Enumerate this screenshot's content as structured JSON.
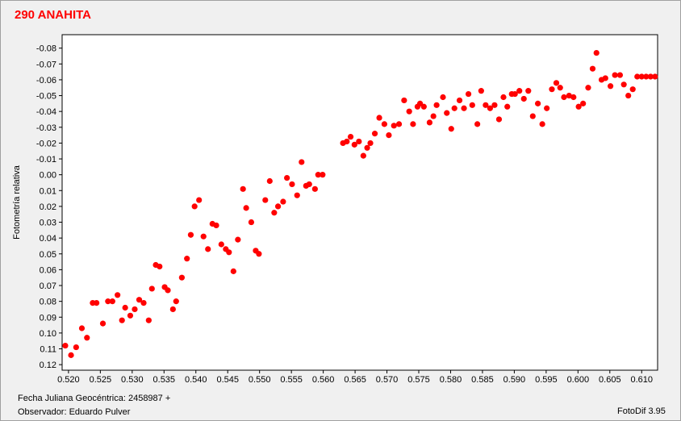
{
  "chart_data": {
    "type": "scatter",
    "title": "290 ANAHITA",
    "xlabel": "Fecha Juliana Geocéntrica: 2458987 +",
    "ylabel": "Fotometría relativa",
    "xlim": [
      0.519,
      0.6125
    ],
    "ylim": [
      -0.0885,
      0.1235
    ],
    "y_inverted": true,
    "grid": false,
    "x_ticks": [
      0.52,
      0.525,
      0.53,
      0.535,
      0.54,
      0.545,
      0.55,
      0.555,
      0.56,
      0.565,
      0.57,
      0.575,
      0.58,
      0.585,
      0.59,
      0.595,
      0.6,
      0.605,
      0.61
    ],
    "x_tick_labels": [
      "0.520",
      "0.525",
      "0.530",
      "0.535",
      "0.540",
      "0.545",
      "0.550",
      "0.555",
      "0.560",
      "0.565",
      "0.570",
      "0.575",
      "0.580",
      "0.585",
      "0.590",
      "0.595",
      "0.600",
      "0.605",
      "0.610"
    ],
    "y_ticks": [
      -0.08,
      -0.07,
      -0.06,
      -0.05,
      -0.04,
      -0.03,
      -0.02,
      -0.01,
      0.0,
      0.01,
      0.02,
      0.03,
      0.04,
      0.05,
      0.06,
      0.07,
      0.08,
      0.09,
      0.1,
      0.11,
      0.12
    ],
    "y_tick_labels": [
      "-0.08",
      "-0.07",
      "-0.06",
      "-0.05",
      "-0.04",
      "-0.03",
      "-0.02",
      "-0.01",
      "0.00",
      "0.01",
      "0.02",
      "0.03",
      "0.04",
      "0.05",
      "0.06",
      "0.07",
      "0.08",
      "0.09",
      "0.10",
      "0.11",
      "0.12"
    ],
    "point_color": "#ff0000",
    "series": [
      {
        "points": [
          [
            0.5195,
            0.108
          ],
          [
            0.5204,
            0.114
          ],
          [
            0.5212,
            0.109
          ],
          [
            0.5221,
            0.097
          ],
          [
            0.5229,
            0.103
          ],
          [
            0.5238,
            0.081
          ],
          [
            0.5244,
            0.081
          ],
          [
            0.5254,
            0.094
          ],
          [
            0.5262,
            0.08
          ],
          [
            0.5269,
            0.08
          ],
          [
            0.5277,
            0.076
          ],
          [
            0.5284,
            0.092
          ],
          [
            0.5289,
            0.084
          ],
          [
            0.5297,
            0.089
          ],
          [
            0.5304,
            0.085
          ],
          [
            0.5311,
            0.079
          ],
          [
            0.5318,
            0.081
          ],
          [
            0.5326,
            0.092
          ],
          [
            0.5331,
            0.072
          ],
          [
            0.5337,
            0.057
          ],
          [
            0.5343,
            0.058
          ],
          [
            0.5351,
            0.071
          ],
          [
            0.5356,
            0.073
          ],
          [
            0.5364,
            0.085
          ],
          [
            0.5369,
            0.08
          ],
          [
            0.5378,
            0.065
          ],
          [
            0.5386,
            0.053
          ],
          [
            0.5392,
            0.038
          ],
          [
            0.5398,
            0.02
          ],
          [
            0.5405,
            0.016
          ],
          [
            0.5412,
            0.039
          ],
          [
            0.5419,
            0.047
          ],
          [
            0.5426,
            0.031
          ],
          [
            0.5432,
            0.032
          ],
          [
            0.544,
            0.044
          ],
          [
            0.5447,
            0.047
          ],
          [
            0.5452,
            0.049
          ],
          [
            0.5459,
            0.061
          ],
          [
            0.5466,
            0.041
          ],
          [
            0.5474,
            0.009
          ],
          [
            0.5479,
            0.021
          ],
          [
            0.5487,
            0.03
          ],
          [
            0.5494,
            0.048
          ],
          [
            0.5499,
            0.05
          ],
          [
            0.5509,
            0.016
          ],
          [
            0.5516,
            0.004
          ],
          [
            0.5523,
            0.024
          ],
          [
            0.5529,
            0.02
          ],
          [
            0.5537,
            0.017
          ],
          [
            0.5543,
            0.002
          ],
          [
            0.5551,
            0.006
          ],
          [
            0.5559,
            0.013
          ],
          [
            0.5566,
            -0.008
          ],
          [
            0.5573,
            0.007
          ],
          [
            0.5578,
            0.006
          ],
          [
            0.5587,
            0.009
          ],
          [
            0.5592,
            0.0
          ],
          [
            0.5599,
            0.0
          ],
          [
            0.5631,
            -0.02
          ],
          [
            0.5637,
            -0.021
          ],
          [
            0.5643,
            -0.024
          ],
          [
            0.5649,
            -0.019
          ],
          [
            0.5656,
            -0.021
          ],
          [
            0.5663,
            -0.012
          ],
          [
            0.5669,
            -0.017
          ],
          [
            0.5674,
            -0.02
          ],
          [
            0.5681,
            -0.026
          ],
          [
            0.5688,
            -0.036
          ],
          [
            0.5696,
            -0.032
          ],
          [
            0.5703,
            -0.025
          ],
          [
            0.5711,
            -0.031
          ],
          [
            0.5719,
            -0.032
          ],
          [
            0.5727,
            -0.047
          ],
          [
            0.5735,
            -0.04
          ],
          [
            0.5741,
            -0.032
          ],
          [
            0.5748,
            -0.043
          ],
          [
            0.5752,
            -0.045
          ],
          [
            0.5758,
            -0.043
          ],
          [
            0.5767,
            -0.033
          ],
          [
            0.5773,
            -0.037
          ],
          [
            0.5778,
            -0.044
          ],
          [
            0.5788,
            -0.049
          ],
          [
            0.5794,
            -0.039
          ],
          [
            0.5801,
            -0.029
          ],
          [
            0.5806,
            -0.042
          ],
          [
            0.5814,
            -0.047
          ],
          [
            0.5821,
            -0.042
          ],
          [
            0.5828,
            -0.051
          ],
          [
            0.5834,
            -0.044
          ],
          [
            0.5842,
            -0.032
          ],
          [
            0.5848,
            -0.053
          ],
          [
            0.5855,
            -0.044
          ],
          [
            0.5862,
            -0.042
          ],
          [
            0.5869,
            -0.044
          ],
          [
            0.5876,
            -0.035
          ],
          [
            0.5883,
            -0.049
          ],
          [
            0.5889,
            -0.043
          ],
          [
            0.5896,
            -0.051
          ],
          [
            0.5901,
            -0.051
          ],
          [
            0.5908,
            -0.053
          ],
          [
            0.5915,
            -0.048
          ],
          [
            0.5922,
            -0.053
          ],
          [
            0.5929,
            -0.037
          ],
          [
            0.5937,
            -0.045
          ],
          [
            0.5944,
            -0.032
          ],
          [
            0.5951,
            -0.042
          ],
          [
            0.5959,
            -0.054
          ],
          [
            0.5966,
            -0.058
          ],
          [
            0.5972,
            -0.055
          ],
          [
            0.5978,
            -0.049
          ],
          [
            0.5986,
            -0.05
          ],
          [
            0.5993,
            -0.049
          ],
          [
            0.6001,
            -0.043
          ],
          [
            0.6008,
            -0.045
          ],
          [
            0.6016,
            -0.055
          ],
          [
            0.6023,
            -0.067
          ],
          [
            0.6029,
            -0.077
          ],
          [
            0.6037,
            -0.06
          ],
          [
            0.6043,
            -0.061
          ],
          [
            0.6051,
            -0.056
          ],
          [
            0.6058,
            -0.063
          ],
          [
            0.6066,
            -0.063
          ],
          [
            0.6072,
            -0.057
          ],
          [
            0.6079,
            -0.05
          ],
          [
            0.6086,
            -0.054
          ],
          [
            0.6093,
            -0.062
          ],
          [
            0.61,
            -0.062
          ],
          [
            0.6107,
            -0.062
          ],
          [
            0.6114,
            -0.062
          ],
          [
            0.6121,
            -0.062
          ]
        ]
      }
    ]
  },
  "footer": {
    "observer": "Observador: Eduardo Pulver",
    "software": "FotoDif 3.95"
  }
}
